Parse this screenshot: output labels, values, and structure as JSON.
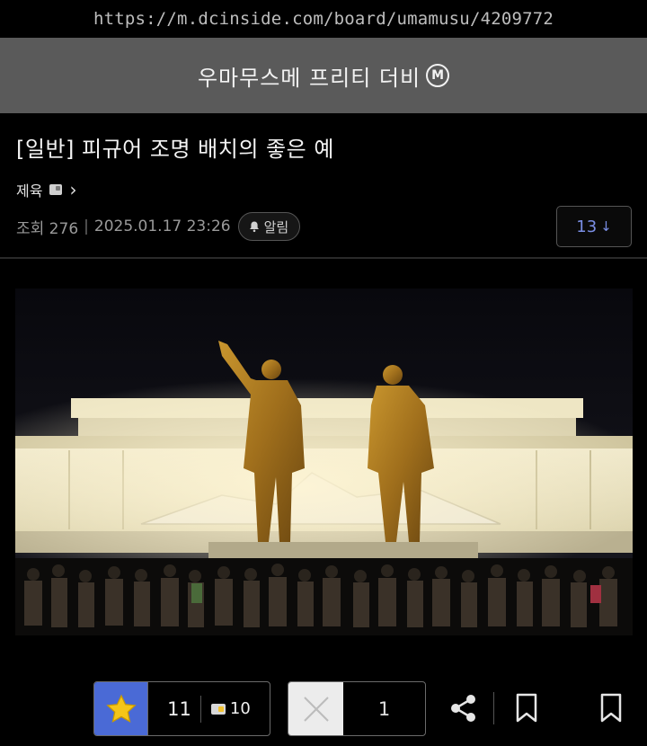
{
  "browser": {
    "url": "https://m.dcinside.com/board/umamusu/4209772"
  },
  "gallery": {
    "title": "우마무스메 프리티 더비",
    "badge": "M"
  },
  "post": {
    "title": "[일반] 피규어 조명 배치의 좋은 예",
    "author": "제육",
    "views_label": "조회 276",
    "datetime": "2025.01.17 23:26",
    "alarm_label": "알림",
    "comment_count": "13",
    "image_icon": "photo-figure-statues-night"
  },
  "actions": {
    "recommend_count": "11",
    "fixed_recommend_count": "10",
    "downvote_count": "1",
    "share_icon": "share-icon",
    "bookmark_icon": "bookmark-icon"
  },
  "colors": {
    "header_bg": "#5a5a5a",
    "accent_blue": "#4a6ad6",
    "comment_count_color": "#7b8fe6",
    "background": "#000000"
  }
}
